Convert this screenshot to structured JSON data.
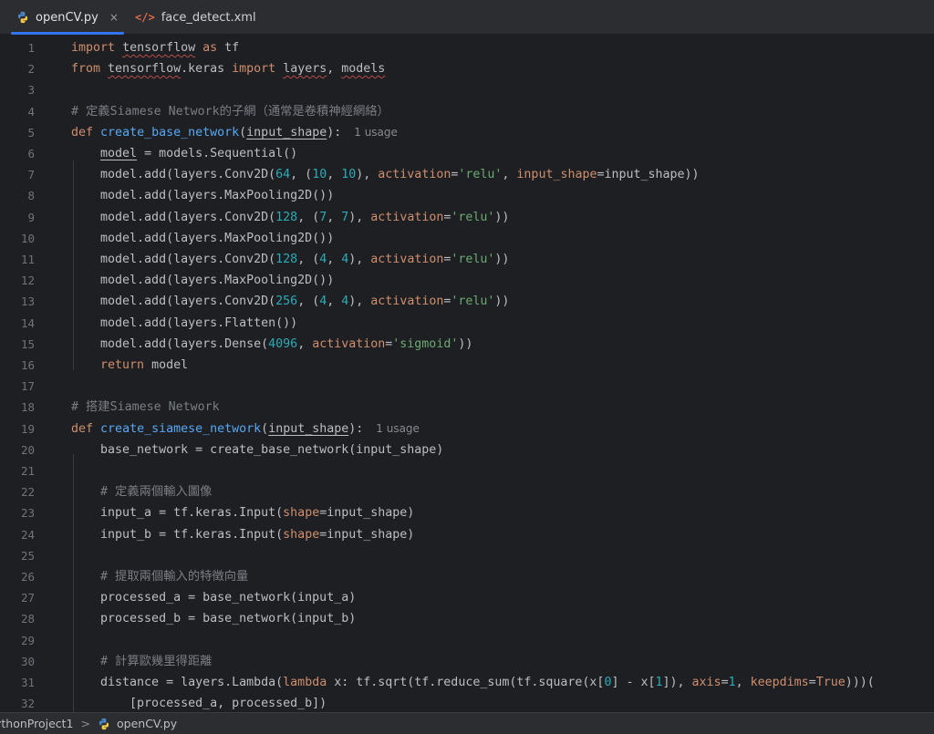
{
  "tabs": [
    {
      "label": "openCV.py",
      "icon": "python-file-icon",
      "active": true,
      "close": "×"
    },
    {
      "label": "face_detect.xml",
      "icon": "xml-file-icon",
      "active": false
    }
  ],
  "breadcrumb": {
    "project": "ythonProject1",
    "separator": ">",
    "file": "openCV.py"
  },
  "colors": {
    "accent": "#3574f0",
    "keyword": "#cf8e6d",
    "function": "#56a8f5",
    "number": "#2aacb8",
    "string": "#6aab73",
    "comment": "#7a7e85"
  },
  "lines": [
    [
      {
        "t": "import",
        "c": "kw"
      },
      {
        "t": " "
      },
      {
        "t": "tensorflow",
        "c": "sq"
      },
      {
        "t": " "
      },
      {
        "t": "as",
        "c": "kw"
      },
      {
        "t": " tf"
      }
    ],
    [
      {
        "t": "from",
        "c": "kw"
      },
      {
        "t": " "
      },
      {
        "t": "tensorflow",
        "c": "sq"
      },
      {
        "t": ".keras "
      },
      {
        "t": "import",
        "c": "kw"
      },
      {
        "t": " "
      },
      {
        "t": "layers",
        "c": "sq"
      },
      {
        "t": ", "
      },
      {
        "t": "models",
        "c": "sq"
      }
    ],
    [],
    [
      {
        "t": "# 定義Siamese Network的子網（通常是卷積神經網絡）",
        "c": "cm"
      }
    ],
    [
      {
        "t": "def",
        "c": "kw"
      },
      {
        "t": " "
      },
      {
        "t": "create_base_network",
        "c": "fn"
      },
      {
        "t": "("
      },
      {
        "t": "input_shape",
        "c": "pu"
      },
      {
        "t": "):"
      },
      {
        "t": "1 usage",
        "c": "hint"
      }
    ],
    [
      {
        "t": "    "
      },
      {
        "t": "model",
        "c": "pu"
      },
      {
        "t": " = models.Sequential()"
      }
    ],
    [
      {
        "t": "    model.add(layers.Conv2D("
      },
      {
        "t": "64",
        "c": "num"
      },
      {
        "t": ", ("
      },
      {
        "t": "10",
        "c": "num"
      },
      {
        "t": ", "
      },
      {
        "t": "10",
        "c": "num"
      },
      {
        "t": "), "
      },
      {
        "t": "activation",
        "c": "prm"
      },
      {
        "t": "="
      },
      {
        "t": "'relu'",
        "c": "str"
      },
      {
        "t": ", "
      },
      {
        "t": "input_shape",
        "c": "prm"
      },
      {
        "t": "=input_shape))"
      }
    ],
    [
      {
        "t": "    model.add(layers.MaxPooling2D())"
      }
    ],
    [
      {
        "t": "    model.add(layers.Conv2D("
      },
      {
        "t": "128",
        "c": "num"
      },
      {
        "t": ", ("
      },
      {
        "t": "7",
        "c": "num"
      },
      {
        "t": ", "
      },
      {
        "t": "7",
        "c": "num"
      },
      {
        "t": "), "
      },
      {
        "t": "activation",
        "c": "prm"
      },
      {
        "t": "="
      },
      {
        "t": "'relu'",
        "c": "str"
      },
      {
        "t": "))"
      }
    ],
    [
      {
        "t": "    model.add(layers.MaxPooling2D())"
      }
    ],
    [
      {
        "t": "    model.add(layers.Conv2D("
      },
      {
        "t": "128",
        "c": "num"
      },
      {
        "t": ", ("
      },
      {
        "t": "4",
        "c": "num"
      },
      {
        "t": ", "
      },
      {
        "t": "4",
        "c": "num"
      },
      {
        "t": "), "
      },
      {
        "t": "activation",
        "c": "prm"
      },
      {
        "t": "="
      },
      {
        "t": "'relu'",
        "c": "str"
      },
      {
        "t": "))"
      }
    ],
    [
      {
        "t": "    model.add(layers.MaxPooling2D())"
      }
    ],
    [
      {
        "t": "    model.add(layers.Conv2D("
      },
      {
        "t": "256",
        "c": "num"
      },
      {
        "t": ", ("
      },
      {
        "t": "4",
        "c": "num"
      },
      {
        "t": ", "
      },
      {
        "t": "4",
        "c": "num"
      },
      {
        "t": "), "
      },
      {
        "t": "activation",
        "c": "prm"
      },
      {
        "t": "="
      },
      {
        "t": "'relu'",
        "c": "str"
      },
      {
        "t": "))"
      }
    ],
    [
      {
        "t": "    model.add(layers.Flatten())"
      }
    ],
    [
      {
        "t": "    model.add(layers.Dense("
      },
      {
        "t": "4096",
        "c": "num"
      },
      {
        "t": ", "
      },
      {
        "t": "activation",
        "c": "prm"
      },
      {
        "t": "="
      },
      {
        "t": "'sigmoid'",
        "c": "str"
      },
      {
        "t": "))"
      }
    ],
    [
      {
        "t": "    "
      },
      {
        "t": "return",
        "c": "kw"
      },
      {
        "t": " model"
      }
    ],
    [],
    [
      {
        "t": "# 搭建Siamese Network",
        "c": "cm"
      }
    ],
    [
      {
        "t": "def",
        "c": "kw"
      },
      {
        "t": " "
      },
      {
        "t": "create_siamese_network",
        "c": "fn"
      },
      {
        "t": "("
      },
      {
        "t": "input_shape",
        "c": "pu"
      },
      {
        "t": "):"
      },
      {
        "t": "1 usage",
        "c": "hint"
      }
    ],
    [
      {
        "t": "    base_network = create_base_network(input_shape)"
      }
    ],
    [],
    [
      {
        "t": "    "
      },
      {
        "t": "# 定義兩個輸入圖像",
        "c": "cm"
      }
    ],
    [
      {
        "t": "    input_a = tf.keras.Input("
      },
      {
        "t": "shape",
        "c": "prm"
      },
      {
        "t": "=input_shape)"
      }
    ],
    [
      {
        "t": "    input_b = tf.keras.Input("
      },
      {
        "t": "shape",
        "c": "prm"
      },
      {
        "t": "=input_shape)"
      }
    ],
    [],
    [
      {
        "t": "    "
      },
      {
        "t": "# 提取兩個輸入的特徵向量",
        "c": "cm"
      }
    ],
    [
      {
        "t": "    processed_a = base_network(input_a)"
      }
    ],
    [
      {
        "t": "    processed_b = base_network(input_b)"
      }
    ],
    [],
    [
      {
        "t": "    "
      },
      {
        "t": "# 計算歐幾里得距離",
        "c": "cm"
      }
    ],
    [
      {
        "t": "    distance = layers.Lambda("
      },
      {
        "t": "lambda",
        "c": "kw"
      },
      {
        "t": " x: tf.sqrt(tf.reduce_sum(tf.square(x["
      },
      {
        "t": "0",
        "c": "num"
      },
      {
        "t": "] - x["
      },
      {
        "t": "1",
        "c": "num"
      },
      {
        "t": "]), "
      },
      {
        "t": "axis",
        "c": "prm"
      },
      {
        "t": "="
      },
      {
        "t": "1",
        "c": "num"
      },
      {
        "t": ", "
      },
      {
        "t": "keepdims",
        "c": "prm"
      },
      {
        "t": "="
      },
      {
        "t": "True",
        "c": "kw"
      },
      {
        "t": ")))("
      }
    ],
    [
      {
        "t": "        [processed_a, processed_b])"
      }
    ]
  ]
}
